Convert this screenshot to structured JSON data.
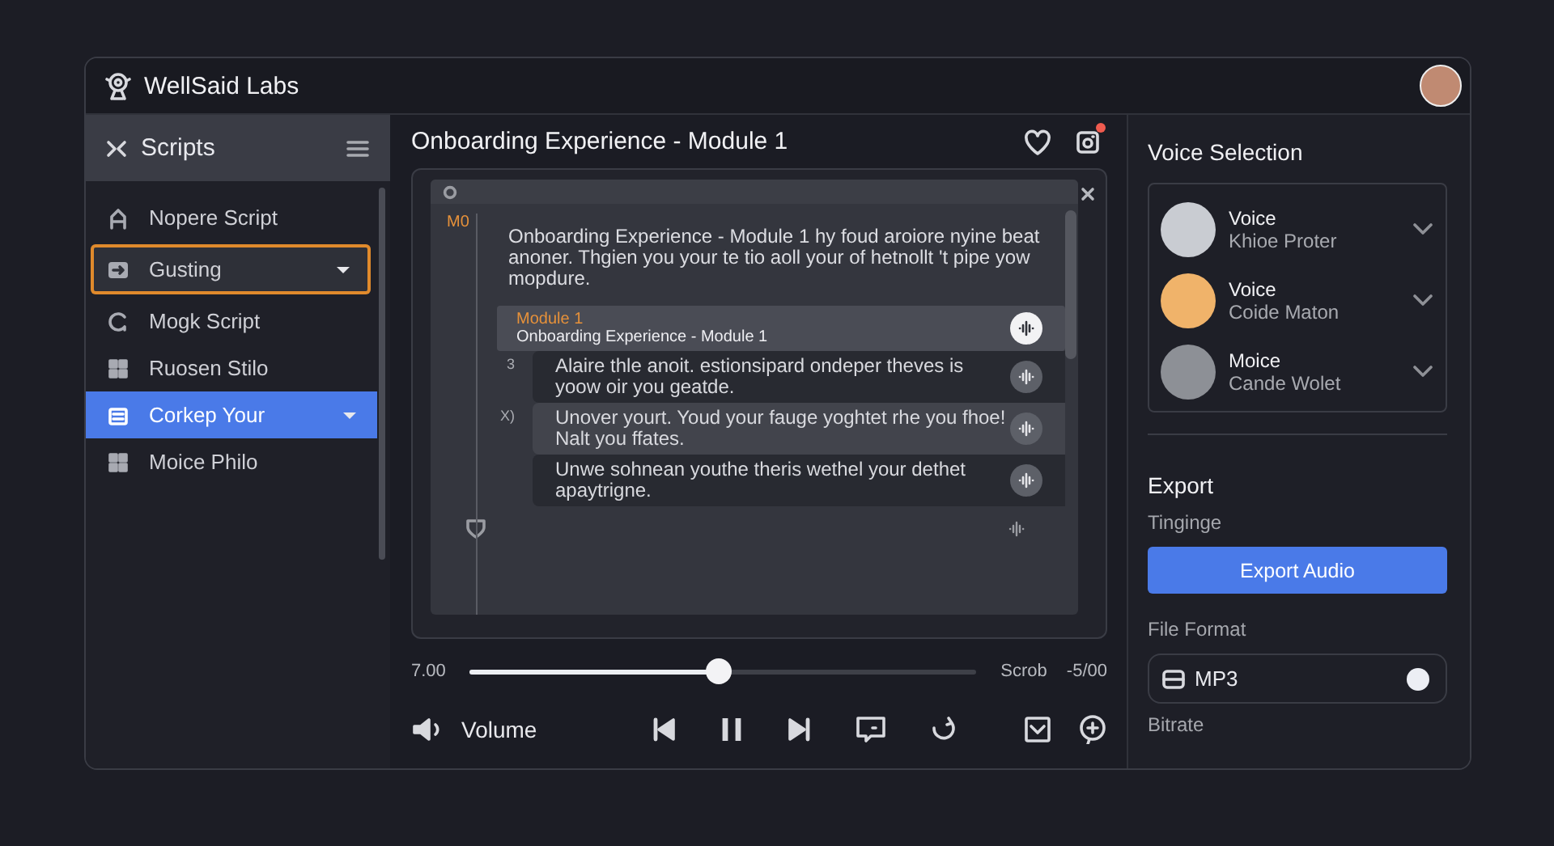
{
  "app": {
    "brand": "WellSaid Labs"
  },
  "sidebar": {
    "title": "Scripts",
    "items": [
      {
        "label": "Nopere Script",
        "selected": false,
        "focused": false,
        "expandable": false
      },
      {
        "label": "Gusting",
        "selected": false,
        "focused": true,
        "expandable": true
      },
      {
        "label": "Mogk Script",
        "selected": false,
        "focused": false,
        "expandable": false
      },
      {
        "label": "Ruosen Stilo",
        "selected": false,
        "focused": false,
        "expandable": false
      },
      {
        "label": "Corkep Your",
        "selected": true,
        "focused": false,
        "expandable": true
      },
      {
        "label": "Moice Philo",
        "selected": false,
        "focused": false,
        "expandable": false
      }
    ]
  },
  "editor": {
    "title": "Onboarding Experience - Module 1",
    "notification": true,
    "blocks": [
      {
        "kind": "intro",
        "marker": "M0",
        "text": "Onboarding Experience - Module 1 hy foud aroiore nyine beat anoner. Thgien you your te tio aoll your of hetnollt 't pipe yow mopdure."
      },
      {
        "kind": "module",
        "selected": true,
        "label": "Module 1",
        "text": "Onboarding Experience - Module 1"
      },
      {
        "kind": "segment",
        "selected": false,
        "marker": "3",
        "text": "Alaire thle anoit. estionsipard ondeper theves is yoow oir you geatde."
      },
      {
        "kind": "segment",
        "selected": false,
        "marker": "X)",
        "text": "Unover yourt. Youd your fauge yoghtet rhe you fhoe! Nalt you ffates."
      },
      {
        "kind": "segment",
        "selected": false,
        "text": "Unwe sohnean youthe theris wethel your dethet apaytrigne."
      },
      {
        "kind": "end"
      }
    ]
  },
  "player": {
    "elapsed": "7.00",
    "level": 0.49,
    "scrub_label": "Scrob",
    "remaining": "-5/00",
    "volume_label": "Volume"
  },
  "voices": {
    "title": "Voice Selection",
    "items": [
      {
        "label": "Voice",
        "name": "Khioe Proter",
        "color": "#c9ccd2"
      },
      {
        "label": "Voice",
        "name": "Coide Maton",
        "color": "#f0b36a"
      },
      {
        "label": "Moice",
        "name": "Cande Wolet",
        "color": "#8d9096"
      }
    ]
  },
  "export": {
    "title": "Export",
    "subtitle": "Tinginge",
    "button": "Export Audio",
    "format_label": "File Format",
    "format": "MP3",
    "format_on": true,
    "bitrate_label": "Bitrate"
  }
}
